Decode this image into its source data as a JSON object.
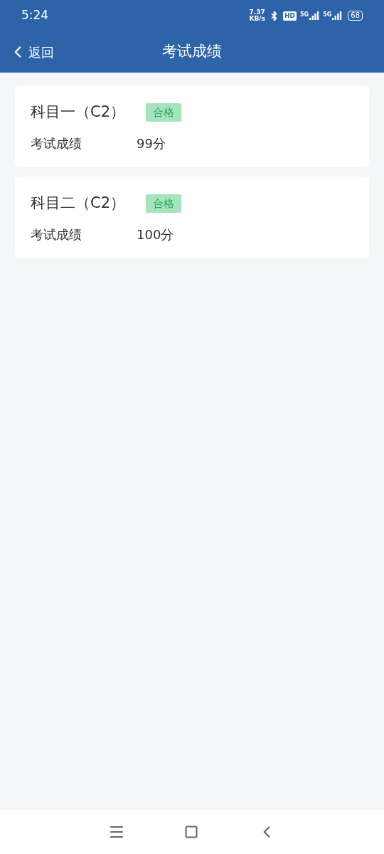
{
  "status_bar": {
    "time": "5:24",
    "net_speed_value": "7.37",
    "net_speed_unit": "KB/s",
    "hd": "HD",
    "signals": [
      "5G",
      "5G"
    ],
    "battery": "68"
  },
  "nav": {
    "back": "返回",
    "title": "考试成绩"
  },
  "results": [
    {
      "subject": "科目一（C2）",
      "passed": true,
      "badge": "合格",
      "label": "考试成绩",
      "score": "99分"
    },
    {
      "subject": "科目二（C2）",
      "passed": true,
      "badge": "合格",
      "label": "考试成绩",
      "score": "100分"
    }
  ]
}
